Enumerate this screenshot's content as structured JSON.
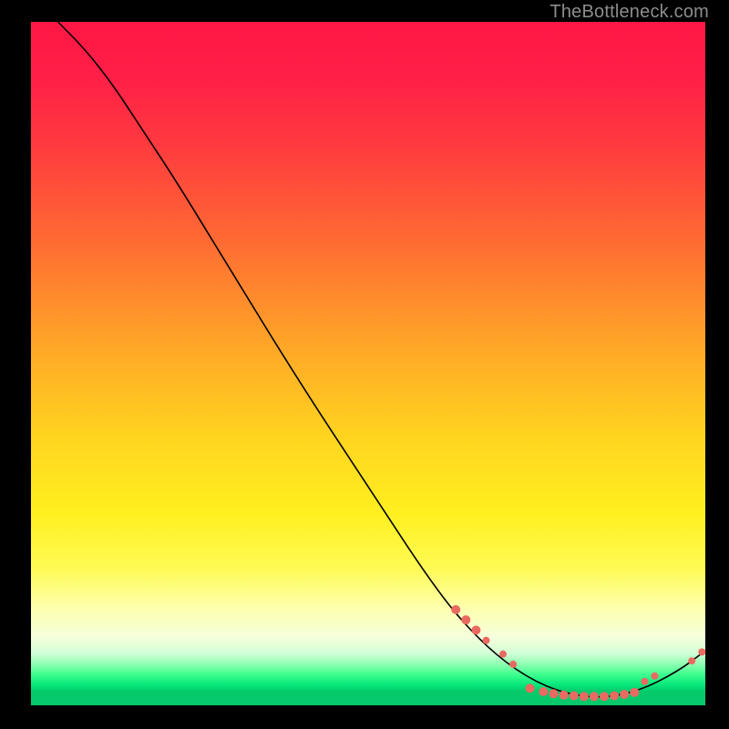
{
  "watermark": "TheBottleneck.com",
  "colors": {
    "background": "#000000",
    "curve": "#000000",
    "marker": "#ea6a61",
    "gradient_top": "#ff1745",
    "gradient_bottom": "#05c96b"
  },
  "chart_data": {
    "type": "line",
    "title": "",
    "xlabel": "",
    "ylabel": "",
    "xlim": [
      0,
      100
    ],
    "ylim": [
      0,
      100
    ],
    "curve": [
      {
        "x": 4,
        "y": 100
      },
      {
        "x": 8,
        "y": 96
      },
      {
        "x": 12,
        "y": 91
      },
      {
        "x": 16,
        "y": 85
      },
      {
        "x": 22,
        "y": 76
      },
      {
        "x": 30,
        "y": 63
      },
      {
        "x": 40,
        "y": 47
      },
      {
        "x": 50,
        "y": 32
      },
      {
        "x": 60,
        "y": 17
      },
      {
        "x": 66,
        "y": 10
      },
      {
        "x": 72,
        "y": 5
      },
      {
        "x": 78,
        "y": 2
      },
      {
        "x": 84,
        "y": 1
      },
      {
        "x": 90,
        "y": 2
      },
      {
        "x": 96,
        "y": 5
      },
      {
        "x": 100,
        "y": 8
      }
    ],
    "markers": [
      {
        "x": 63,
        "y": 14,
        "r": 5
      },
      {
        "x": 64.5,
        "y": 12.5,
        "r": 5
      },
      {
        "x": 66,
        "y": 11,
        "r": 5
      },
      {
        "x": 67.5,
        "y": 9.5,
        "r": 4
      },
      {
        "x": 70,
        "y": 7.5,
        "r": 4
      },
      {
        "x": 71.5,
        "y": 6,
        "r": 4
      },
      {
        "x": 74,
        "y": 2.5,
        "r": 5
      },
      {
        "x": 76,
        "y": 2,
        "r": 5
      },
      {
        "x": 77.5,
        "y": 1.7,
        "r": 5
      },
      {
        "x": 79,
        "y": 1.5,
        "r": 5
      },
      {
        "x": 80.5,
        "y": 1.4,
        "r": 5
      },
      {
        "x": 82,
        "y": 1.3,
        "r": 5
      },
      {
        "x": 83.5,
        "y": 1.3,
        "r": 5
      },
      {
        "x": 85,
        "y": 1.3,
        "r": 5
      },
      {
        "x": 86.5,
        "y": 1.4,
        "r": 5
      },
      {
        "x": 88,
        "y": 1.6,
        "r": 5
      },
      {
        "x": 89.5,
        "y": 1.9,
        "r": 5
      },
      {
        "x": 91,
        "y": 3.5,
        "r": 4
      },
      {
        "x": 92.5,
        "y": 4.3,
        "r": 4
      },
      {
        "x": 98,
        "y": 6.5,
        "r": 4
      },
      {
        "x": 99.5,
        "y": 7.8,
        "r": 4
      }
    ]
  }
}
